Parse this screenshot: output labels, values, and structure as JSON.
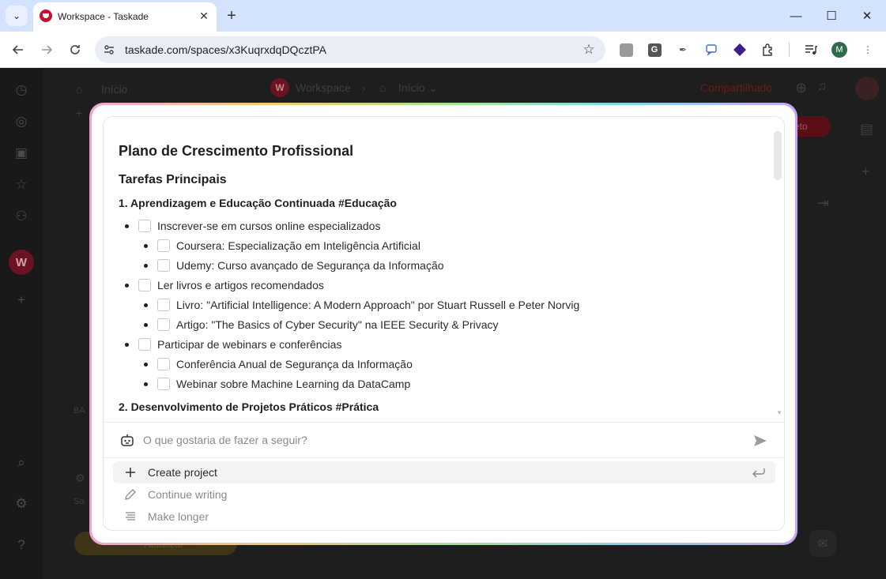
{
  "browser": {
    "tab_title": "Workspace - Taskade",
    "url": "taskade.com/spaces/x3KuqrxdqDQcztPA",
    "profile_initial": "M",
    "extension_g_letter": "G",
    "window_controls": {
      "minimize": "—",
      "maximize": "☐",
      "close": "✕"
    }
  },
  "background_app": {
    "sidebar_home": "Início",
    "workspace_initial": "W",
    "header_workspace": "Workspace",
    "header_home": "Início",
    "share_label": "Compartilhado",
    "pill_text": "eto",
    "left_fragment": "BA",
    "left_fragment2": "So",
    "upgrade_label": "Atualizar"
  },
  "document": {
    "title": "Plano de Crescimento Profissional",
    "subtitle": "Tarefas Principais",
    "section1_heading": "1. Aprendizagem e Educação Continuada #Educação",
    "tasks": [
      {
        "text": "Inscrever-se em cursos online especializados",
        "level": 1
      },
      {
        "text": "Coursera: Especialização em Inteligência Artificial",
        "level": 2
      },
      {
        "text": "Udemy: Curso avançado de Segurança da Informação",
        "level": 2
      },
      {
        "text": "Ler livros e artigos recomendados",
        "level": 1
      },
      {
        "text": "Livro: \"Artificial Intelligence: A Modern Approach\" por Stuart Russell e Peter Norvig",
        "level": 2
      },
      {
        "text": "Artigo: \"The Basics of Cyber Security\" na IEEE Security & Privacy",
        "level": 2
      },
      {
        "text": "Participar de webinars e conferências",
        "level": 1
      },
      {
        "text": "Conferência Anual de Segurança da Informação",
        "level": 2
      },
      {
        "text": "Webinar sobre Machine Learning da DataCamp",
        "level": 2
      }
    ],
    "section2_heading": "2. Desenvolvimento de Projetos Práticos #Prática"
  },
  "prompt": {
    "placeholder": "O que gostaria de fazer a seguir?"
  },
  "suggestions": [
    {
      "label": "Create project",
      "icon": "plus-icon"
    },
    {
      "label": "Continue writing",
      "icon": "pencil-icon"
    },
    {
      "label": "Make longer",
      "icon": "lines-icon"
    }
  ],
  "colors": {
    "accent_red": "#c8102e",
    "modal_gradient": [
      "#f3a2d8",
      "#f7c873",
      "#a6e58b",
      "#7fd9e6",
      "#c9a5f7"
    ]
  }
}
